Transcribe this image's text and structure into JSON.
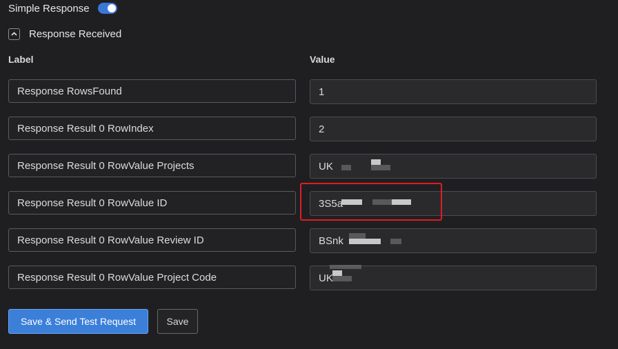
{
  "simple_response": {
    "label": "Simple Response",
    "enabled": true
  },
  "section": {
    "title": "Response Received",
    "expanded": true,
    "icon": "chevron-up-icon"
  },
  "columns": {
    "label": "Label",
    "value": "Value"
  },
  "rows": [
    {
      "label": "Response RowsFound",
      "value": "1"
    },
    {
      "label": "Response Result 0 RowIndex",
      "value": "2"
    },
    {
      "label": "Response Result 0 RowValue Projects",
      "value": "UK"
    },
    {
      "label": "Response Result 0 RowValue ID",
      "value": "3S5a"
    },
    {
      "label": "Response Result 0 RowValue Review ID",
      "value": "BSnk"
    },
    {
      "label": "Response Result 0 RowValue Project Code",
      "value": "UK"
    }
  ],
  "buttons": {
    "send": "Save & Send Test Request",
    "save": "Save"
  },
  "colors": {
    "accent": "#3b7fd9",
    "highlight": "#e01c22",
    "background": "#1f1f22"
  }
}
